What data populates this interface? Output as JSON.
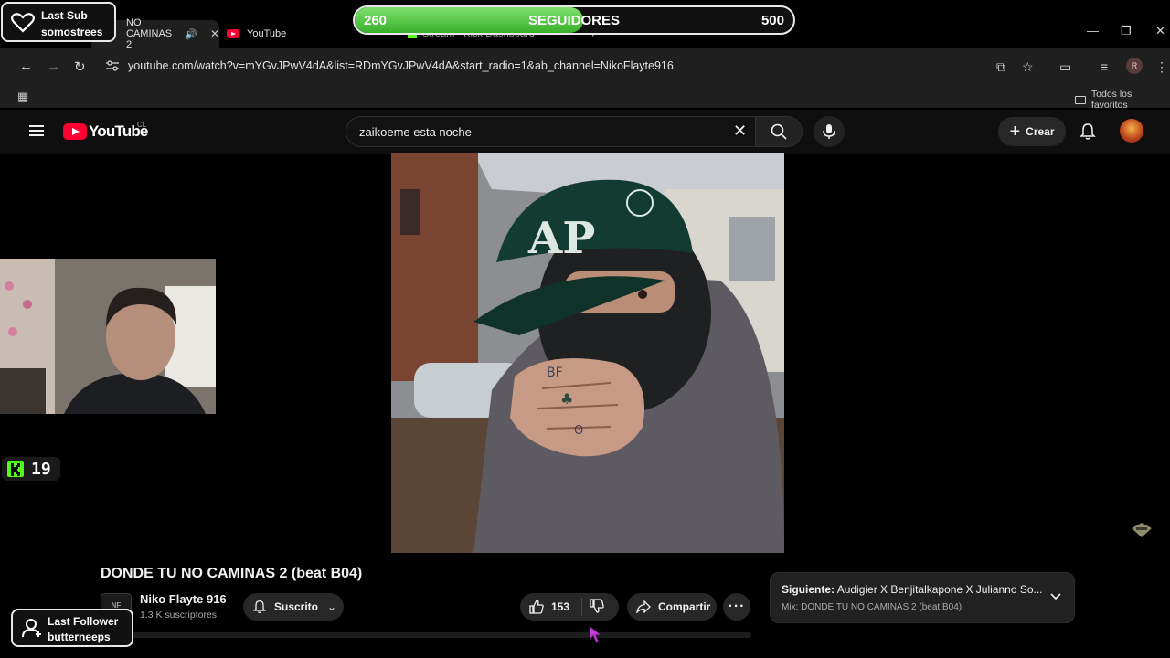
{
  "browser": {
    "tabs": [
      {
        "label": "NO CAMINAS 2",
        "active": true
      },
      {
        "label": "YouTube"
      },
      {
        "label": "Stream - Kick Dashboard"
      }
    ],
    "url": "youtube.com/watch?v=mYGvJPwV4dA&list=RDmYGvJPwV4dA&start_radio=1&ab_channel=NikoFlayte916",
    "profile_initial": "R",
    "bookmarks_folder": "Todos los favoritos"
  },
  "youtube": {
    "logo_text": "YouTube",
    "country_code": "CL",
    "search_value": "zaikoeme esta noche",
    "create_label": "Crear"
  },
  "video": {
    "title": "DONDE TU NO CAMINAS 2 (beat B04)",
    "channel_name": "Niko Flayte 916",
    "subscribers": "1.3 K suscriptores",
    "subscribed_label": "Suscrito",
    "likes": "153",
    "share_label": "Compartir"
  },
  "up_next": {
    "prefix": "Siguiente:",
    "title": "Audigier X Benjitalkapone X Julianno So...",
    "mix": "Mix: DONDE TU NO CAMINAS 2 (beat B04)"
  },
  "overlays": {
    "last_sub_label": "Last Sub",
    "last_sub_name": "somostrees",
    "goal_current": "260",
    "goal_label": "SEGUIDORES",
    "goal_target": "500",
    "goal_progress": 0.52,
    "kick_viewers": "19",
    "last_follower_label": "Last Follower",
    "last_follower_name": "butterneeps"
  },
  "colors": {
    "youtube_red": "#ff0033",
    "kick_green": "#53fc18",
    "goal_green": "#38b02a"
  }
}
